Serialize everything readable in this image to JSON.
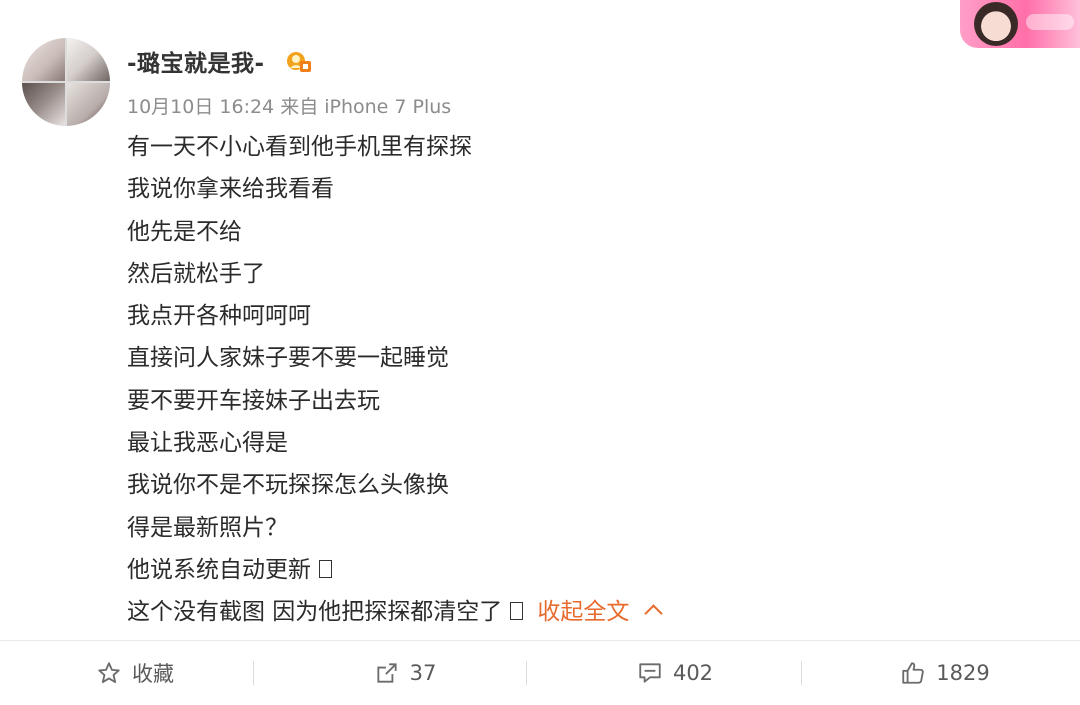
{
  "post": {
    "username": "-璐宝就是我-",
    "meta": "10月10日 16:24 来自 iPhone 7 Plus",
    "lines": [
      "有一天不小心看到他手机里有探探",
      "我说你拿来给我看看",
      "他先是不给",
      "然后就松手了",
      "我点开各种呵呵呵",
      "直接问人家妹子要不要一起睡觉",
      "要不要开车接妹子出去玩",
      "最让我恶心得是",
      "我说你不是不玩探探怎么头像换",
      "得是最新照片？",
      "他说系统自动更新",
      "这个没有截图 因为他把探探都清空了"
    ],
    "collapse_label": "收起全文"
  },
  "actions": {
    "favorite_label": "收藏",
    "repost_count": "37",
    "comment_count": "402",
    "like_count": "1829"
  },
  "icons": {
    "favorite": "star-icon",
    "repost": "share-icon",
    "comment": "comment-icon",
    "like": "thumb-up-icon"
  },
  "colors": {
    "link": "#e86b2e",
    "meta": "#8c8c8c",
    "text": "#2b2b2b"
  }
}
